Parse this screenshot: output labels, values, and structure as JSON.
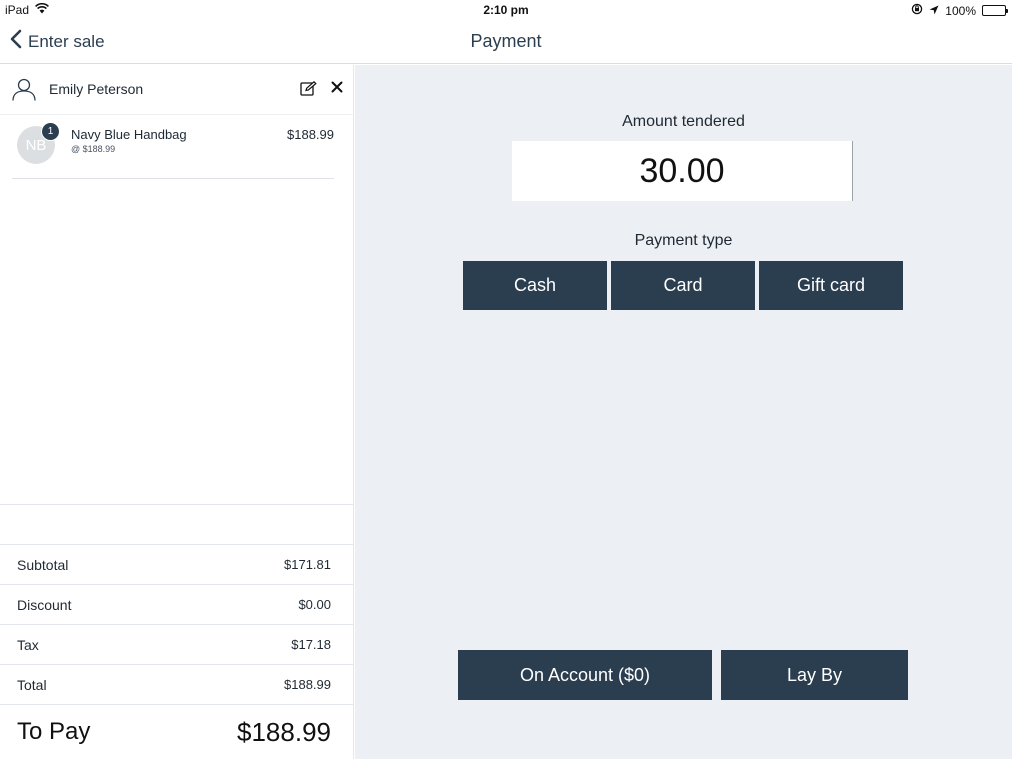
{
  "status_bar": {
    "device": "iPad",
    "time": "2:10 pm",
    "battery": "100%"
  },
  "nav": {
    "back_label": "Enter sale",
    "title": "Payment"
  },
  "customer": {
    "name": "Emily Peterson"
  },
  "line_items": [
    {
      "initials": "NB",
      "quantity": "1",
      "name": "Navy Blue Handbag",
      "unit_price": "@ $188.99",
      "price": "$188.99"
    }
  ],
  "totals": {
    "subtotal_label": "Subtotal",
    "subtotal_value": "$171.81",
    "discount_label": "Discount",
    "discount_value": "$0.00",
    "tax_label": "Tax",
    "tax_value": "$17.18",
    "total_label": "Total",
    "total_value": "$188.99",
    "topay_label": "To Pay",
    "topay_value": "$188.99"
  },
  "payment": {
    "amount_label": "Amount tendered",
    "amount_value": "30.00",
    "type_label": "Payment type",
    "cash_label": "Cash",
    "card_label": "Card",
    "gift_label": "Gift card",
    "account_label": "On Account ($0)",
    "layby_label": "Lay By"
  },
  "colors": {
    "primary": "#2b3e50",
    "panel_background": "#ecf0f4"
  }
}
